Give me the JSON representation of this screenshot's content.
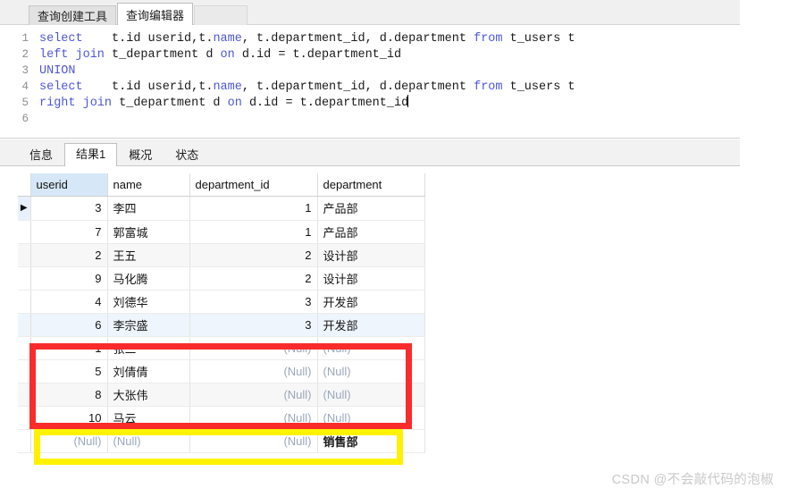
{
  "window": {
    "editor_tabs": [
      {
        "label": "查询创建工具",
        "active": false
      },
      {
        "label": "查询编辑器",
        "active": true
      }
    ]
  },
  "editor": {
    "lines": [
      {
        "number": "1",
        "segments": [
          {
            "text": "select",
            "type": "keyword"
          },
          {
            "text": "    t.id userid,t.",
            "type": "plain"
          },
          {
            "text": "name",
            "type": "keyword"
          },
          {
            "text": ", t.department_id, d.department ",
            "type": "plain"
          },
          {
            "text": "from",
            "type": "keyword"
          },
          {
            "text": " t_users t",
            "type": "plain"
          }
        ]
      },
      {
        "number": "2",
        "segments": [
          {
            "text": "left join",
            "type": "keyword"
          },
          {
            "text": " t_department d ",
            "type": "plain"
          },
          {
            "text": "on",
            "type": "keyword"
          },
          {
            "text": " d.id = t.department_id",
            "type": "plain"
          }
        ]
      },
      {
        "number": "3",
        "segments": [
          {
            "text": "UNION",
            "type": "keyword"
          }
        ]
      },
      {
        "number": "4",
        "segments": [
          {
            "text": "select",
            "type": "keyword"
          },
          {
            "text": "    t.id userid,t.",
            "type": "plain"
          },
          {
            "text": "name",
            "type": "keyword"
          },
          {
            "text": ", t.department_id, d.department ",
            "type": "plain"
          },
          {
            "text": "from",
            "type": "keyword"
          },
          {
            "text": " t_users t",
            "type": "plain"
          }
        ]
      },
      {
        "number": "5",
        "segments": [
          {
            "text": "right join",
            "type": "keyword"
          },
          {
            "text": " t_department d ",
            "type": "plain"
          },
          {
            "text": "on",
            "type": "keyword"
          },
          {
            "text": " d.id = t.department_id",
            "type": "plain"
          }
        ],
        "caret": true
      },
      {
        "number": "6",
        "segments": []
      }
    ]
  },
  "results": {
    "tabs": [
      {
        "label": "信息",
        "active": false
      },
      {
        "label": "结果1",
        "active": true
      },
      {
        "label": "概况",
        "active": false
      },
      {
        "label": "状态",
        "active": false
      }
    ],
    "columns": [
      "userid",
      "name",
      "department_id",
      "department"
    ],
    "selected_column": "userid",
    "row_marker": "▶",
    "null_text": "(Null)",
    "rows": [
      {
        "marker": "▶",
        "userid": "3",
        "name": "李四",
        "department_id": "1",
        "department": "产品部",
        "style": "current"
      },
      {
        "marker": "",
        "userid": "7",
        "name": "郭富城",
        "department_id": "1",
        "department": "产品部",
        "style": "normal"
      },
      {
        "marker": "",
        "userid": "2",
        "name": "王五",
        "department_id": "2",
        "department": "设计部",
        "style": "alt"
      },
      {
        "marker": "",
        "userid": "9",
        "name": "马化腾",
        "department_id": "2",
        "department": "设计部",
        "style": "normal"
      },
      {
        "marker": "",
        "userid": "4",
        "name": "刘德华",
        "department_id": "3",
        "department": "开发部",
        "style": "normal"
      },
      {
        "marker": "",
        "userid": "6",
        "name": "李宗盛",
        "department_id": "3",
        "department": "开发部",
        "style": "hl"
      },
      {
        "marker": "",
        "userid": "1",
        "name": "张三",
        "department_id": "(Null)",
        "department": "(Null)",
        "style": "normal"
      },
      {
        "marker": "",
        "userid": "5",
        "name": "刘倩倩",
        "department_id": "(Null)",
        "department": "(Null)",
        "style": "normal"
      },
      {
        "marker": "",
        "userid": "8",
        "name": "大张伟",
        "department_id": "(Null)",
        "department": "(Null)",
        "style": "alt"
      },
      {
        "marker": "",
        "userid": "10",
        "name": "马云",
        "department_id": "(Null)",
        "department": "(Null)",
        "style": "normal"
      },
      {
        "marker": "",
        "userid": "(Null)",
        "name": "(Null)",
        "department_id": "(Null)",
        "department": "销售部",
        "style": "normal"
      }
    ]
  },
  "annotations": {
    "red_box": {
      "color": "#fa2b2b",
      "covers": "rows 1,5,8,10 with (Null) department"
    },
    "yellow_box": {
      "color": "#fff200",
      "covers": "row with (Null) userid and 销售部 department"
    }
  },
  "watermark": {
    "text": "CSDN @不会敲代码的泡椒"
  }
}
